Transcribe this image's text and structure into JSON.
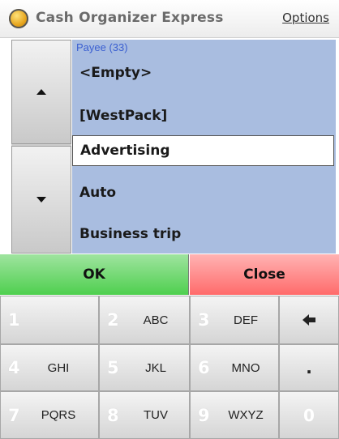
{
  "titlebar": {
    "title": "Cash Organizer Express",
    "options_label": "Options"
  },
  "list": {
    "header": "Payee (33)",
    "items": [
      {
        "label": "<Empty>"
      },
      {
        "label": "[WestPack]"
      },
      {
        "label": "Advertising",
        "selected": true
      },
      {
        "label": "Auto"
      },
      {
        "label": "Business trip"
      }
    ]
  },
  "actions": {
    "ok_label": "OK",
    "close_label": "Close",
    "ok_color": "#4fcf4f",
    "close_color": "#ff6b6b"
  },
  "keypad": {
    "keys": [
      {
        "digit": "1",
        "letters": ""
      },
      {
        "digit": "2",
        "letters": "ABC"
      },
      {
        "digit": "3",
        "letters": "DEF"
      },
      {
        "symbol": "backspace-arrow"
      },
      {
        "digit": "4",
        "letters": "GHI"
      },
      {
        "digit": "5",
        "letters": "JKL"
      },
      {
        "digit": "6",
        "letters": "MNO"
      },
      {
        "symbol": "."
      },
      {
        "digit": "7",
        "letters": "PQRS"
      },
      {
        "digit": "8",
        "letters": "TUV"
      },
      {
        "digit": "9",
        "letters": "WXYZ"
      },
      {
        "digit": "0",
        "letters": ""
      }
    ]
  },
  "icons": {
    "app_icon": "coin-icon",
    "up": "arrow-up-icon",
    "down": "arrow-down-icon",
    "backspace": "backspace-icon"
  }
}
